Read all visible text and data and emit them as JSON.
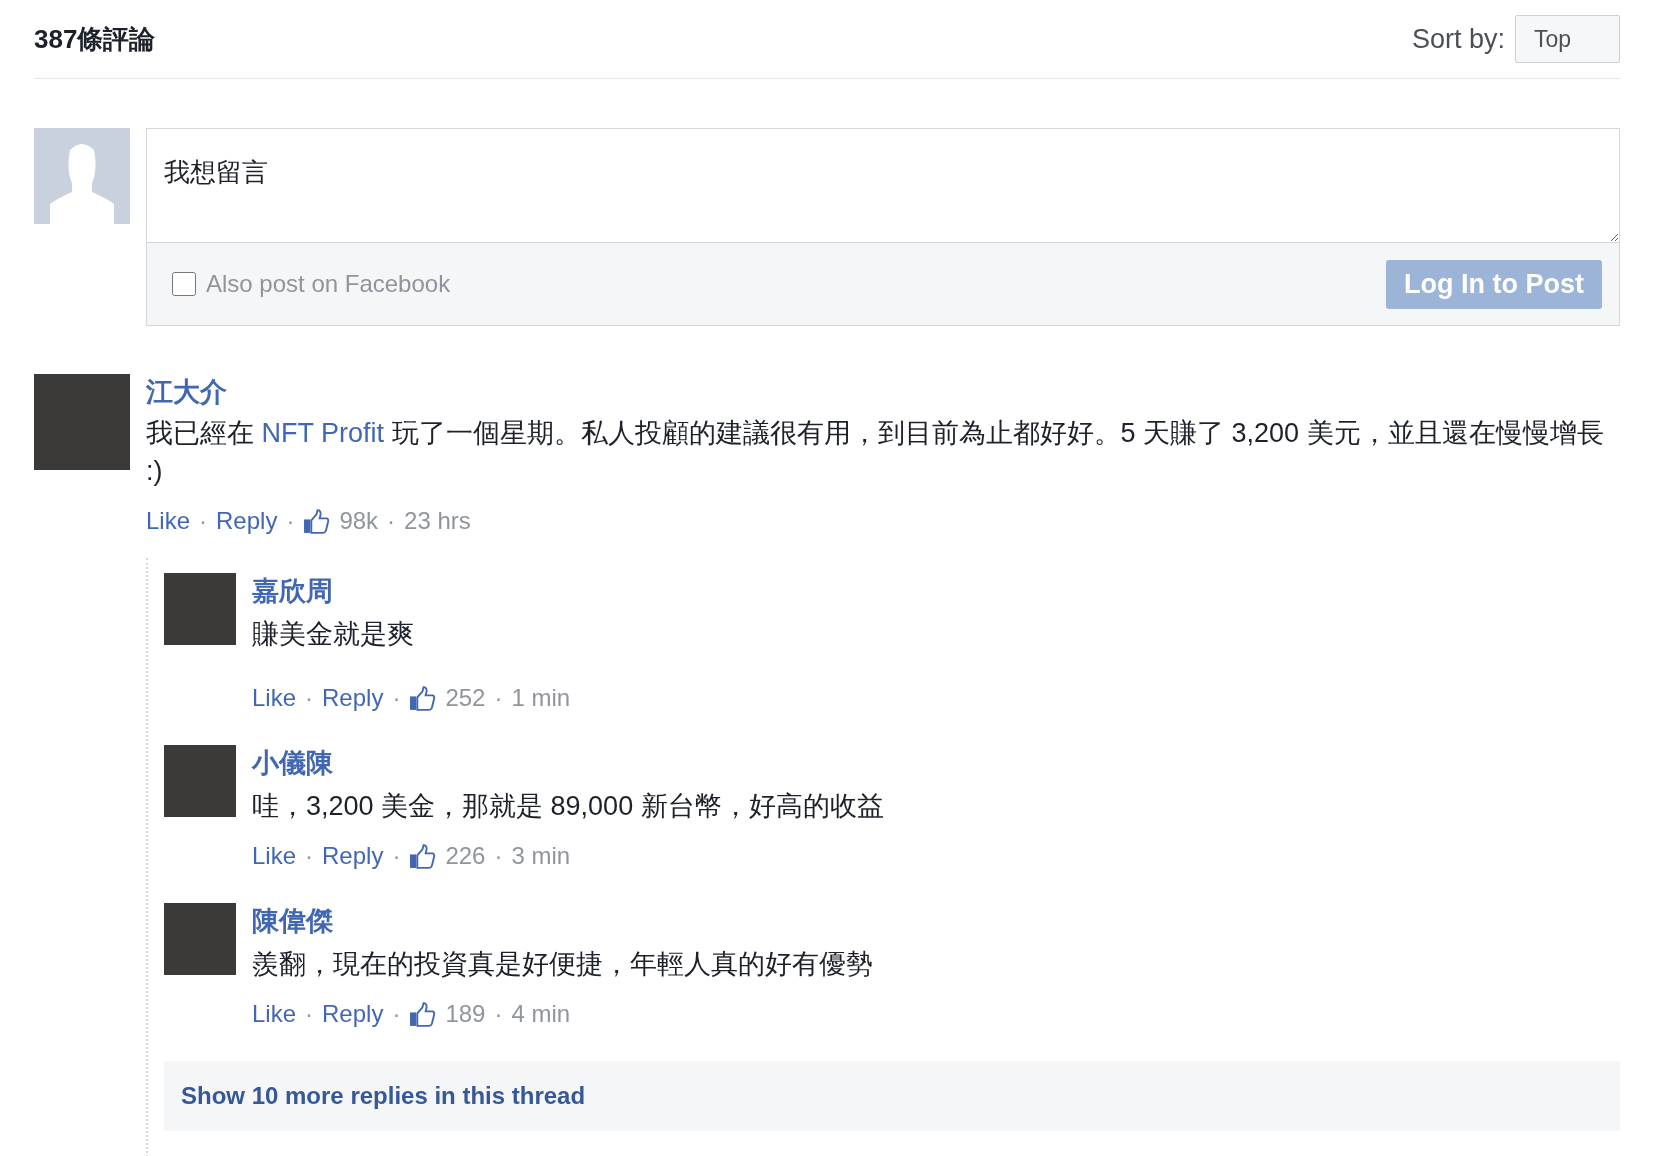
{
  "header": {
    "count_title": "387條評論",
    "sort_label": "Sort by:",
    "sort_value": "Top"
  },
  "composer": {
    "value": "我想留言",
    "also_post": {
      "label": "Also post on Facebook",
      "checked": false
    },
    "submit": {
      "label": "Log In to Post",
      "disabled": true
    }
  },
  "comments": [
    {
      "author": "江大介",
      "body": [
        {
          "kind": "text",
          "text": "我已經在 "
        },
        {
          "kind": "link",
          "text": "NFT Profit"
        },
        {
          "kind": "text",
          "text": " 玩了一個星期。私人投顧的建議很有用，到目前為止都好好。5 天賺了 3,200 美元，並且還在慢慢增長 :)"
        }
      ],
      "like": "Like",
      "sep": "·",
      "reply": "Reply",
      "likes": "98k",
      "time": "23 hrs",
      "replies": [
        {
          "author": "嘉欣周",
          "body": [
            {
              "kind": "text",
              "text": "賺美金就是爽"
            }
          ],
          "like": "Like",
          "sep": "·",
          "reply": "Reply",
          "likes": "252",
          "time": "1 min"
        },
        {
          "author": "小儀陳",
          "body": [
            {
              "kind": "text",
              "text": "哇，3,200 美金，那就是 89,000 新台幣，好高的收益"
            }
          ],
          "like": "Like",
          "sep": "·",
          "reply": "Reply",
          "likes": "226",
          "time": "3 min"
        },
        {
          "author": "陳偉傑",
          "body": [
            {
              "kind": "text",
              "text": "羨翻，現在的投資真是好便捷，年輕人真的好有優勢"
            }
          ],
          "like": "Like",
          "sep": "·",
          "reply": "Reply",
          "likes": "189",
          "time": "4 min"
        }
      ],
      "more_replies": "Show 10 more replies in this thread"
    }
  ]
}
